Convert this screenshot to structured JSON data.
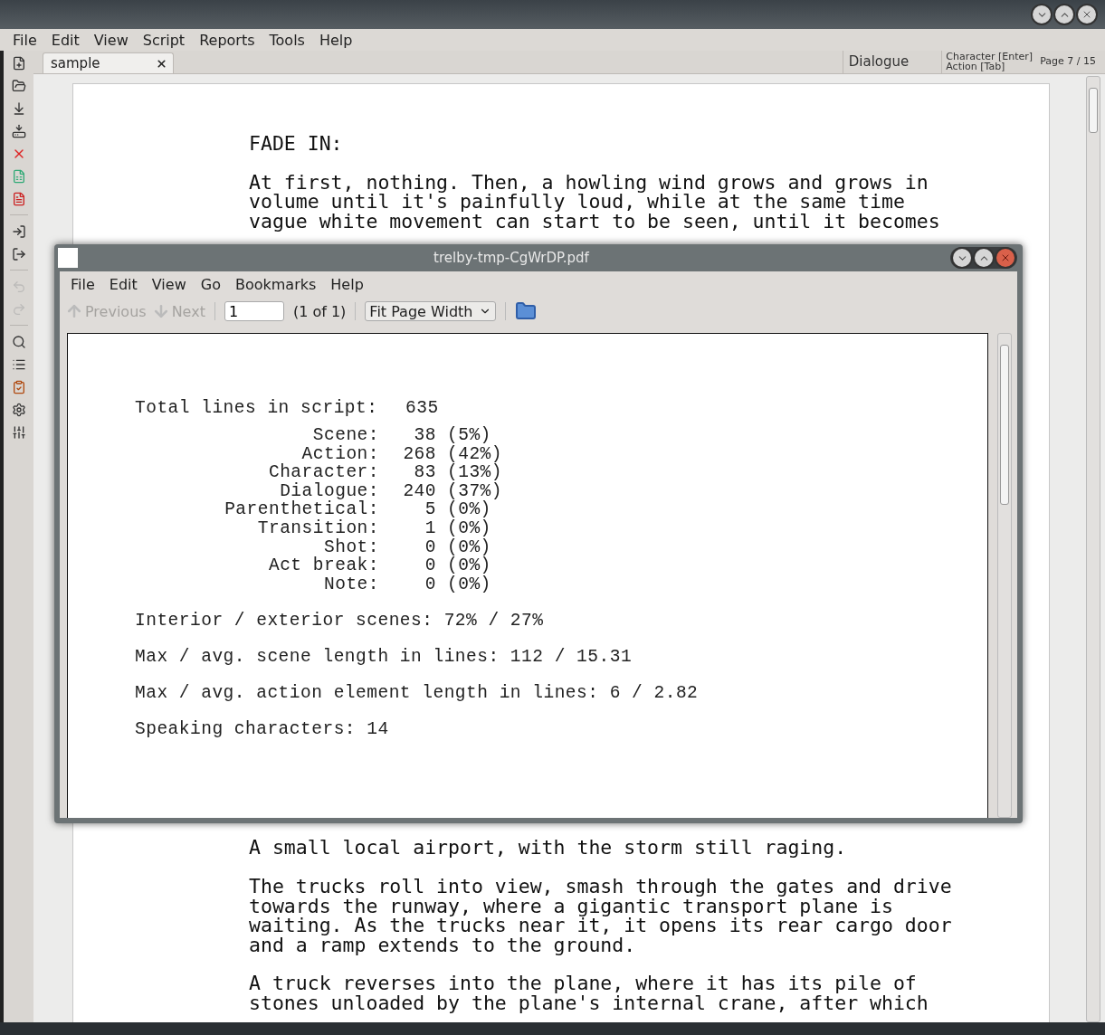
{
  "menu": [
    "File",
    "Edit",
    "View",
    "Script",
    "Reports",
    "Tools",
    "Help"
  ],
  "tabs": [
    {
      "label": "sample",
      "selected": true
    }
  ],
  "status": {
    "element": "Dialogue",
    "hints": [
      "Character [Enter]",
      "Action [Tab]"
    ],
    "page": "Page 7 / 15"
  },
  "toolbar": [
    {
      "kind": "new",
      "disabled": false
    },
    {
      "kind": "open",
      "disabled": false
    },
    {
      "kind": "save",
      "disabled": false
    },
    {
      "kind": "save_as",
      "disabled": false
    },
    {
      "kind": "close",
      "disabled": false
    },
    {
      "kind": "report",
      "disabled": false
    },
    {
      "kind": "pdf",
      "disabled": false
    },
    {
      "kind": "separator"
    },
    {
      "kind": "import",
      "disabled": false
    },
    {
      "kind": "export",
      "disabled": false
    },
    {
      "kind": "separator"
    },
    {
      "kind": "undo",
      "disabled": true
    },
    {
      "kind": "redo",
      "disabled": true
    },
    {
      "kind": "separator"
    },
    {
      "kind": "find",
      "disabled": false
    },
    {
      "kind": "list",
      "disabled": false
    },
    {
      "kind": "checklist",
      "disabled": false
    },
    {
      "kind": "settings",
      "disabled": false
    },
    {
      "kind": "sliders",
      "disabled": false
    }
  ],
  "script_top": [
    {
      "lines": [
        "FADE IN:"
      ]
    },
    {
      "lines": [
        "At first, nothing. Then, a howling wind grows and grows in",
        "volume until it's painfully loud, while at the same time",
        "vague white movement can start to be seen, until it becomes"
      ]
    }
  ],
  "script_bottom": [
    {
      "lines": [
        "A small local airport, with the storm still raging."
      ]
    },
    {
      "lines": [
        "The trucks roll into view, smash through the gates and drive",
        "towards the runway, where a gigantic transport plane is",
        "waiting. As the trucks near it, it opens its rear cargo door",
        "and a ramp extends to the ground."
      ]
    },
    {
      "lines": [
        "A truck reverses into the plane, where it has its pile of",
        "stones unloaded by the plane's internal crane, after which"
      ]
    }
  ],
  "pdf_viewer": {
    "title": "trelby-tmp-CgWrDP.pdf",
    "menu": [
      "File",
      "Edit",
      "View",
      "Go",
      "Bookmarks",
      "Help"
    ],
    "toolbar": {
      "previous": {
        "label": "Previous",
        "disabled": true
      },
      "next": {
        "label": "Next",
        "disabled": true
      },
      "page_value": "1",
      "page_count": "(1 of 1)",
      "zoom": "Fit Page Width"
    },
    "report": {
      "total": {
        "label": "Total lines in script:",
        "value": "635"
      },
      "breakdown": [
        {
          "label": "Scene:",
          "count": "38",
          "percent": "(5%)"
        },
        {
          "label": "Action:",
          "count": "268",
          "percent": "(42%)"
        },
        {
          "label": "Character:",
          "count": "83",
          "percent": "(13%)"
        },
        {
          "label": "Dialogue:",
          "count": "240",
          "percent": "(37%)"
        },
        {
          "label": "Parenthetical:",
          "count": "5",
          "percent": "(0%)"
        },
        {
          "label": "Transition:",
          "count": "1",
          "percent": "(0%)"
        },
        {
          "label": "Shot:",
          "count": "0",
          "percent": "(0%)"
        },
        {
          "label": "Act break:",
          "count": "0",
          "percent": "(0%)"
        },
        {
          "label": "Note:",
          "count": "0",
          "percent": "(0%)"
        }
      ],
      "summary": [
        "Interior / exterior scenes: 72% / 27%",
        "Max / avg. scene length in lines: 112 / 15.31",
        "Max / avg. action element length in lines: 6 / 2.82",
        "Speaking characters: 14"
      ]
    }
  }
}
